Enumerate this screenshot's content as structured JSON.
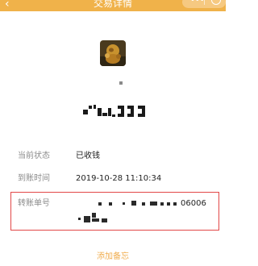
{
  "header": {
    "back_icon": "chevron-left-icon",
    "title": "交易详情",
    "menu_icon": "more-dots-icon",
    "close_icon": "close-ring-icon",
    "bar_color": "#f0b24a"
  },
  "profile": {
    "avatar_icon": "avatar-image",
    "name_text": ""
  },
  "details": {
    "status": {
      "label": "当前状态",
      "value": "已收钱"
    },
    "time": {
      "label": "到账时间",
      "value": "2019-10-28 11:10:34"
    },
    "transfer": {
      "label": "转账单号",
      "value_tail": "06006"
    }
  },
  "highlight_color": "#e24848",
  "add_note": "添加备忘"
}
